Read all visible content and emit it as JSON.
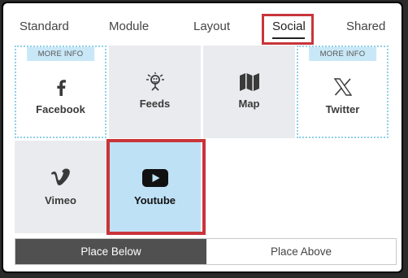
{
  "tabs": [
    {
      "label": "Standard"
    },
    {
      "label": "Module"
    },
    {
      "label": "Layout"
    },
    {
      "label": "Social",
      "active": true
    },
    {
      "label": "Shared"
    }
  ],
  "tiles": {
    "facebook": {
      "label": "Facebook",
      "badge": "MORE INFO",
      "icon": "facebook-icon"
    },
    "feeds": {
      "label": "Feeds",
      "icon": "feeds-icon"
    },
    "map": {
      "label": "Map",
      "icon": "map-icon"
    },
    "twitter": {
      "label": "Twitter",
      "badge": "MORE INFO",
      "icon": "x-twitter-icon"
    },
    "vimeo": {
      "label": "Vimeo",
      "icon": "vimeo-icon"
    },
    "youtube": {
      "label": "Youtube",
      "icon": "youtube-icon",
      "selected": true
    }
  },
  "buttons": {
    "place_below": "Place Below",
    "place_above": "Place Above"
  },
  "colors": {
    "highlight": "#c8353a",
    "selected_tile": "#bfe1f5",
    "badge_bg": "#c9e8f7",
    "dotted_border": "#8fd0ea",
    "active_button": "#505050"
  }
}
